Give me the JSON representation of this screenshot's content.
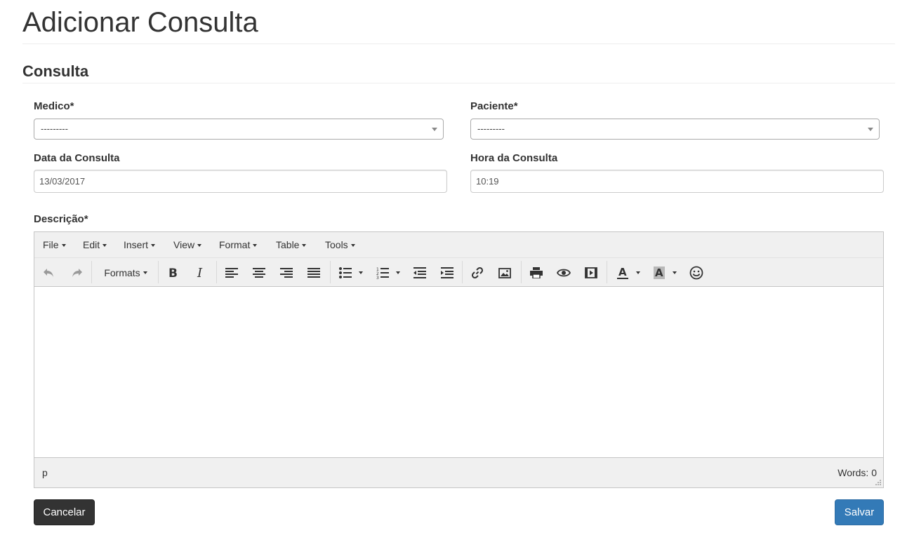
{
  "page": {
    "title": "Adicionar Consulta",
    "section": "Consulta"
  },
  "form": {
    "medico": {
      "label": "Medico*",
      "value": "---------"
    },
    "paciente": {
      "label": "Paciente*",
      "value": "---------"
    },
    "data": {
      "label": "Data da Consulta",
      "value": "13/03/2017"
    },
    "hora": {
      "label": "Hora da Consulta",
      "value": "10:19"
    },
    "descricao": {
      "label": "Descrição*"
    }
  },
  "editor": {
    "menus": [
      "File",
      "Edit",
      "Insert",
      "View",
      "Format",
      "Table",
      "Tools"
    ],
    "formats_label": "Formats",
    "toolbar_icons": [
      "undo-icon",
      "redo-icon",
      "bold-icon",
      "italic-icon",
      "align-left-icon",
      "align-center-icon",
      "align-right-icon",
      "align-justify-icon",
      "bullet-list-icon",
      "numbered-list-icon",
      "outdent-icon",
      "indent-icon",
      "link-icon",
      "image-icon",
      "print-icon",
      "preview-icon",
      "media-icon",
      "text-color-icon",
      "background-color-icon",
      "emoticons-icon"
    ],
    "status_path": "p",
    "word_count": "Words: 0"
  },
  "buttons": {
    "cancel": "Cancelar",
    "save": "Salvar"
  },
  "colors": {
    "primary": "#337ab7",
    "dark": "#333333",
    "toolbar_bg": "#f0f0f0"
  }
}
